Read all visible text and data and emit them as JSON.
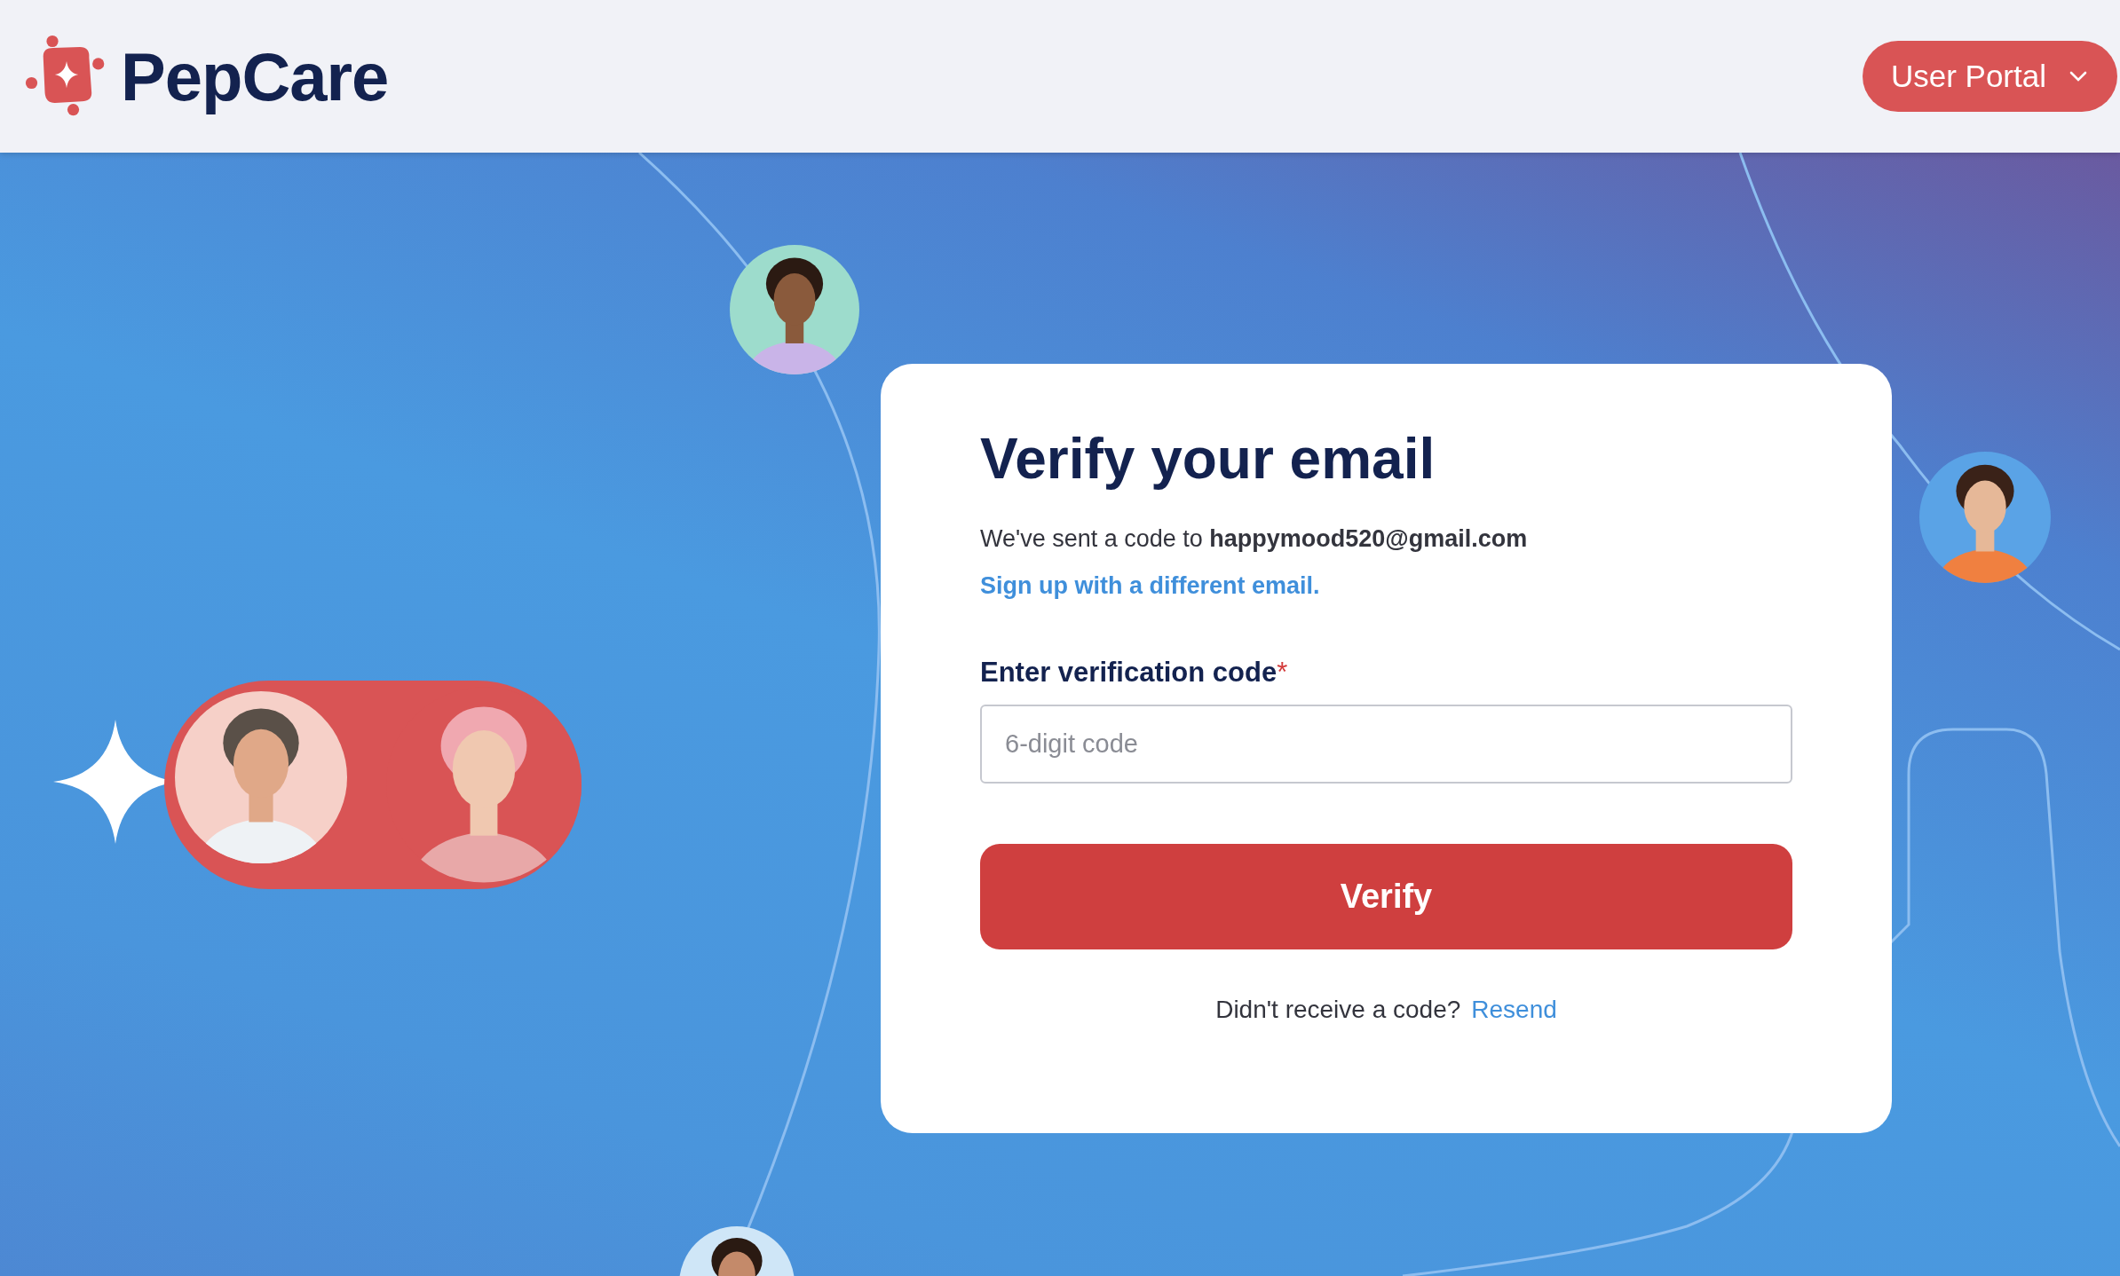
{
  "header": {
    "logo": "PepCare",
    "portal_button": "User Portal"
  },
  "card": {
    "title": "Verify your email",
    "message": "We've sent a code to **happymood520@gmail.com**",
    "change_email_link": "Sign up with a different email.",
    "code_field": {
      "label": "Enter verification code",
      "required_mark": "*",
      "placeholder": "6-digit code"
    },
    "verify_button": "Verify",
    "resend": {
      "prompt": "Didn't receive a code?",
      "link": "Resend"
    }
  }
}
